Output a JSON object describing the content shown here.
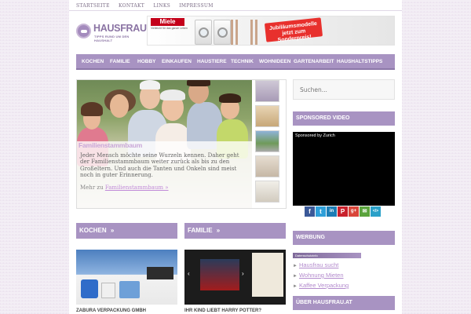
{
  "toplinks": [
    "Startseite",
    "Kontakt",
    "Links",
    "Impressum"
  ],
  "logo": {
    "title": "HAUSFRAU.AT",
    "subtitle": "TIPPS RUND UM DEN HAUSHALT"
  },
  "banner": {
    "brand": "Miele",
    "brand_sub": "Vielleicht für das ganze Leben",
    "promo": "Jubiläumsmodelle jetzt zum Sonderpreis!"
  },
  "nav": [
    "Kochen",
    "Familie",
    "Hobby",
    "Einkaufen",
    "Haustiere",
    "Technik",
    "Wohnideen",
    "Gartenarbeit",
    "Haushaltstipps"
  ],
  "slider": {
    "title": "Familienstammbaum",
    "text": "Jeder Mensch möchte seine Wurzeln kennen. Daher geht der Familienstammbaum weiter zurück als bis zu den Großeltern. Und auch die Tanten und Onkeln sind meist noch in guter Erinnerung.",
    "more_prefix": "Mehr zu",
    "more_link": "Familienstammbaum »"
  },
  "sections": [
    {
      "title": "Kochen",
      "chevron": "»",
      "card_title": "Zabura Verpackung GmbH"
    },
    {
      "title": "Familie",
      "chevron": "»",
      "card_title": "Ihr Kind liebt Harry Potter?"
    }
  ],
  "sidebar": {
    "search_placeholder": "Suchen...",
    "sponsored_title": "Sponsored Video",
    "video_label": "Sponsored by Zurich",
    "share_icons": [
      "facebook-icon",
      "twitter-icon",
      "linkedin-icon",
      "pinterest-icon",
      "googleplus-icon",
      "email-icon",
      "embed-icon"
    ],
    "share_glyphs": [
      "f",
      "t",
      "in",
      "P",
      "g+",
      "✉",
      "</>"
    ],
    "werbung_title": "Werbung",
    "ad_label": "Datenschutzinfo",
    "werbung_links": [
      "Hausfrau sucht",
      "Wohnung Mieten",
      "Kaffee Verpackung"
    ],
    "about_title": "Über Hausfrau.at"
  },
  "colors": {
    "accent": "#a893c2",
    "link": "#b38bcd",
    "background": "#f3eef5"
  }
}
